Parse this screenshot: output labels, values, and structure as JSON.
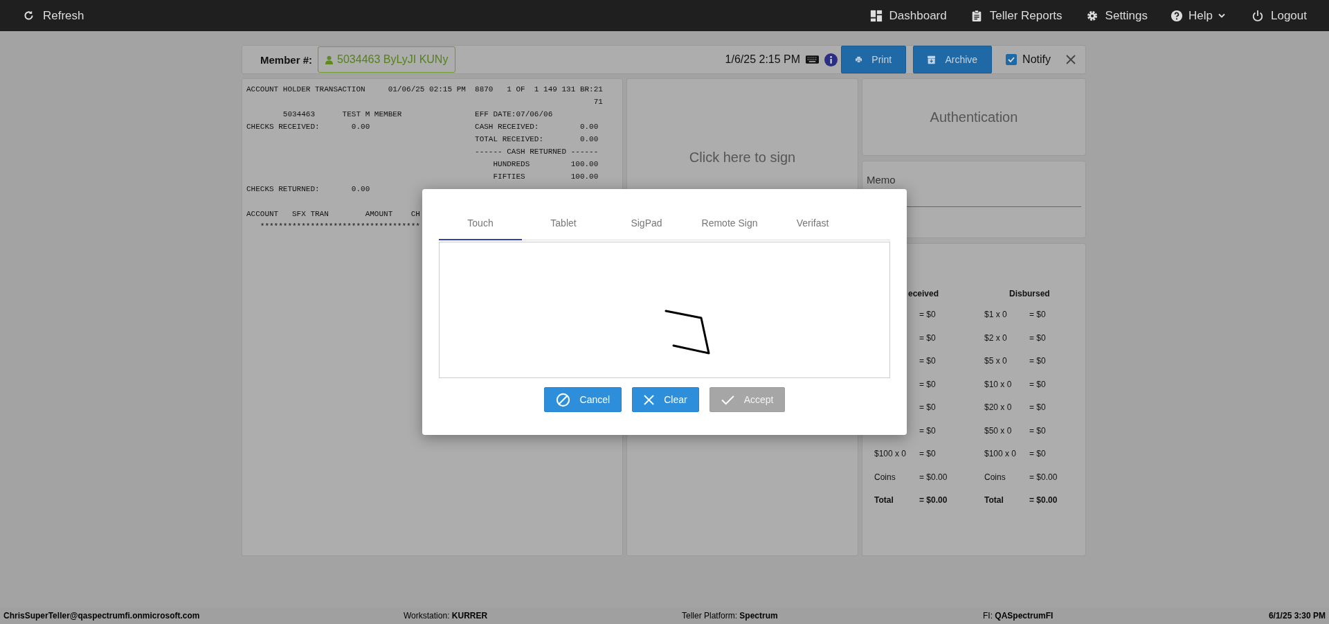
{
  "nav": {
    "refresh": "Refresh",
    "items": [
      {
        "kind": "dashboard",
        "label": "Dashboard"
      },
      {
        "kind": "reports",
        "label": "Teller Reports"
      },
      {
        "kind": "settings",
        "label": "Settings"
      },
      {
        "kind": "help",
        "label": "Help"
      },
      {
        "kind": "logout",
        "label": "Logout"
      }
    ]
  },
  "member_bar": {
    "label": "Member #:",
    "member": "5034463 ByLyJI KUNy",
    "datetime": "1/6/25 2:15 PM",
    "print": "Print",
    "archive": "Archive",
    "notify": {
      "label": "Notify",
      "checked": true
    }
  },
  "receipt": {
    "blocks": [
      [
        "ACCOUNT HOLDER TRANSACTION     01/06/25 02:15 PM  8870   1 OF  1 149 131 BR:21",
        "                                                                            71",
        "        5034463      TEST M MEMBER                EFF DATE:07/06/06",
        "CHECKS RECEIVED:       0.00                       CASH RECEIVED:         0.00",
        "                                                  TOTAL RECEIVED:        0.00",
        "                                                  ------ CASH RETURNED ------",
        "                                                      HUNDREDS         100.00",
        "                                                      FIFTIES          100.00",
        "CHECKS RETURNED:       0.00"
      ],
      [
        "ACCOUNT   SFX TRAN        AMOUNT    CH",
        "   ***********************************"
      ]
    ]
  },
  "signature_panel": {
    "prompt": "Click here to sign"
  },
  "authentication": {
    "title": "Authentication"
  },
  "memo": {
    "label": "Memo"
  },
  "denominations": {
    "received_header": "eceived",
    "disbursed_header": "Disbursed",
    "rows": [
      {
        "kind": "plain",
        "received_value": "= $0",
        "disbursed_label": "$1 x 0",
        "disbursed_value": "= $0"
      },
      {
        "kind": "plain",
        "received_value": "= $0",
        "disbursed_label": "$2 x 0",
        "disbursed_value": "= $0"
      },
      {
        "kind": "plain",
        "received_value": "= $0",
        "disbursed_label": "$5 x 0",
        "disbursed_value": "= $0"
      },
      {
        "kind": "plain",
        "received_value": "= $0",
        "disbursed_label": "$10 x 0",
        "disbursed_value": "= $0"
      },
      {
        "kind": "plain",
        "received_value": "= $0",
        "disbursed_label": "$20 x 0",
        "disbursed_value": "= $0"
      },
      {
        "kind": "plain",
        "received_value": "= $0",
        "disbursed_label": "$50 x 0",
        "disbursed_value": "= $0"
      },
      {
        "kind": "plain",
        "received_label": "$100 x 0",
        "received_value": "= $0",
        "disbursed_label": "$100 x 0",
        "disbursed_value": "= $0"
      },
      {
        "kind": "plain",
        "received_label": "Coins",
        "received_value": "= $0.00",
        "disbursed_label": "Coins",
        "disbursed_value": "= $0.00"
      },
      {
        "kind": "total",
        "received_label": "Total",
        "received_value": "= $0.00",
        "disbursed_label": "Total",
        "disbursed_value": "= $0.00"
      }
    ]
  },
  "modal": {
    "tabs": [
      {
        "label": "Touch",
        "selected": true
      },
      {
        "label": "Tablet",
        "selected": false
      },
      {
        "label": "SigPad",
        "selected": false
      },
      {
        "label": "Remote Sign",
        "selected": false
      },
      {
        "label": "Verifast",
        "selected": false
      }
    ],
    "buttons": [
      {
        "kind": "cancel",
        "label": "Cancel",
        "disabled": false
      },
      {
        "kind": "clear",
        "label": "Clear",
        "disabled": false
      },
      {
        "kind": "accept",
        "label": "Accept",
        "disabled": true
      }
    ]
  },
  "status_bar": {
    "user": "ChrisSuperTeller@qaspectrumfi.onmicrosoft.com",
    "workstation": "Workstation: **KURRER**",
    "platform": "Teller Platform: **Spectrum**",
    "fi": "FI: **QASpectrumFI**",
    "datetime": "6/1/25 3:30 PM"
  }
}
